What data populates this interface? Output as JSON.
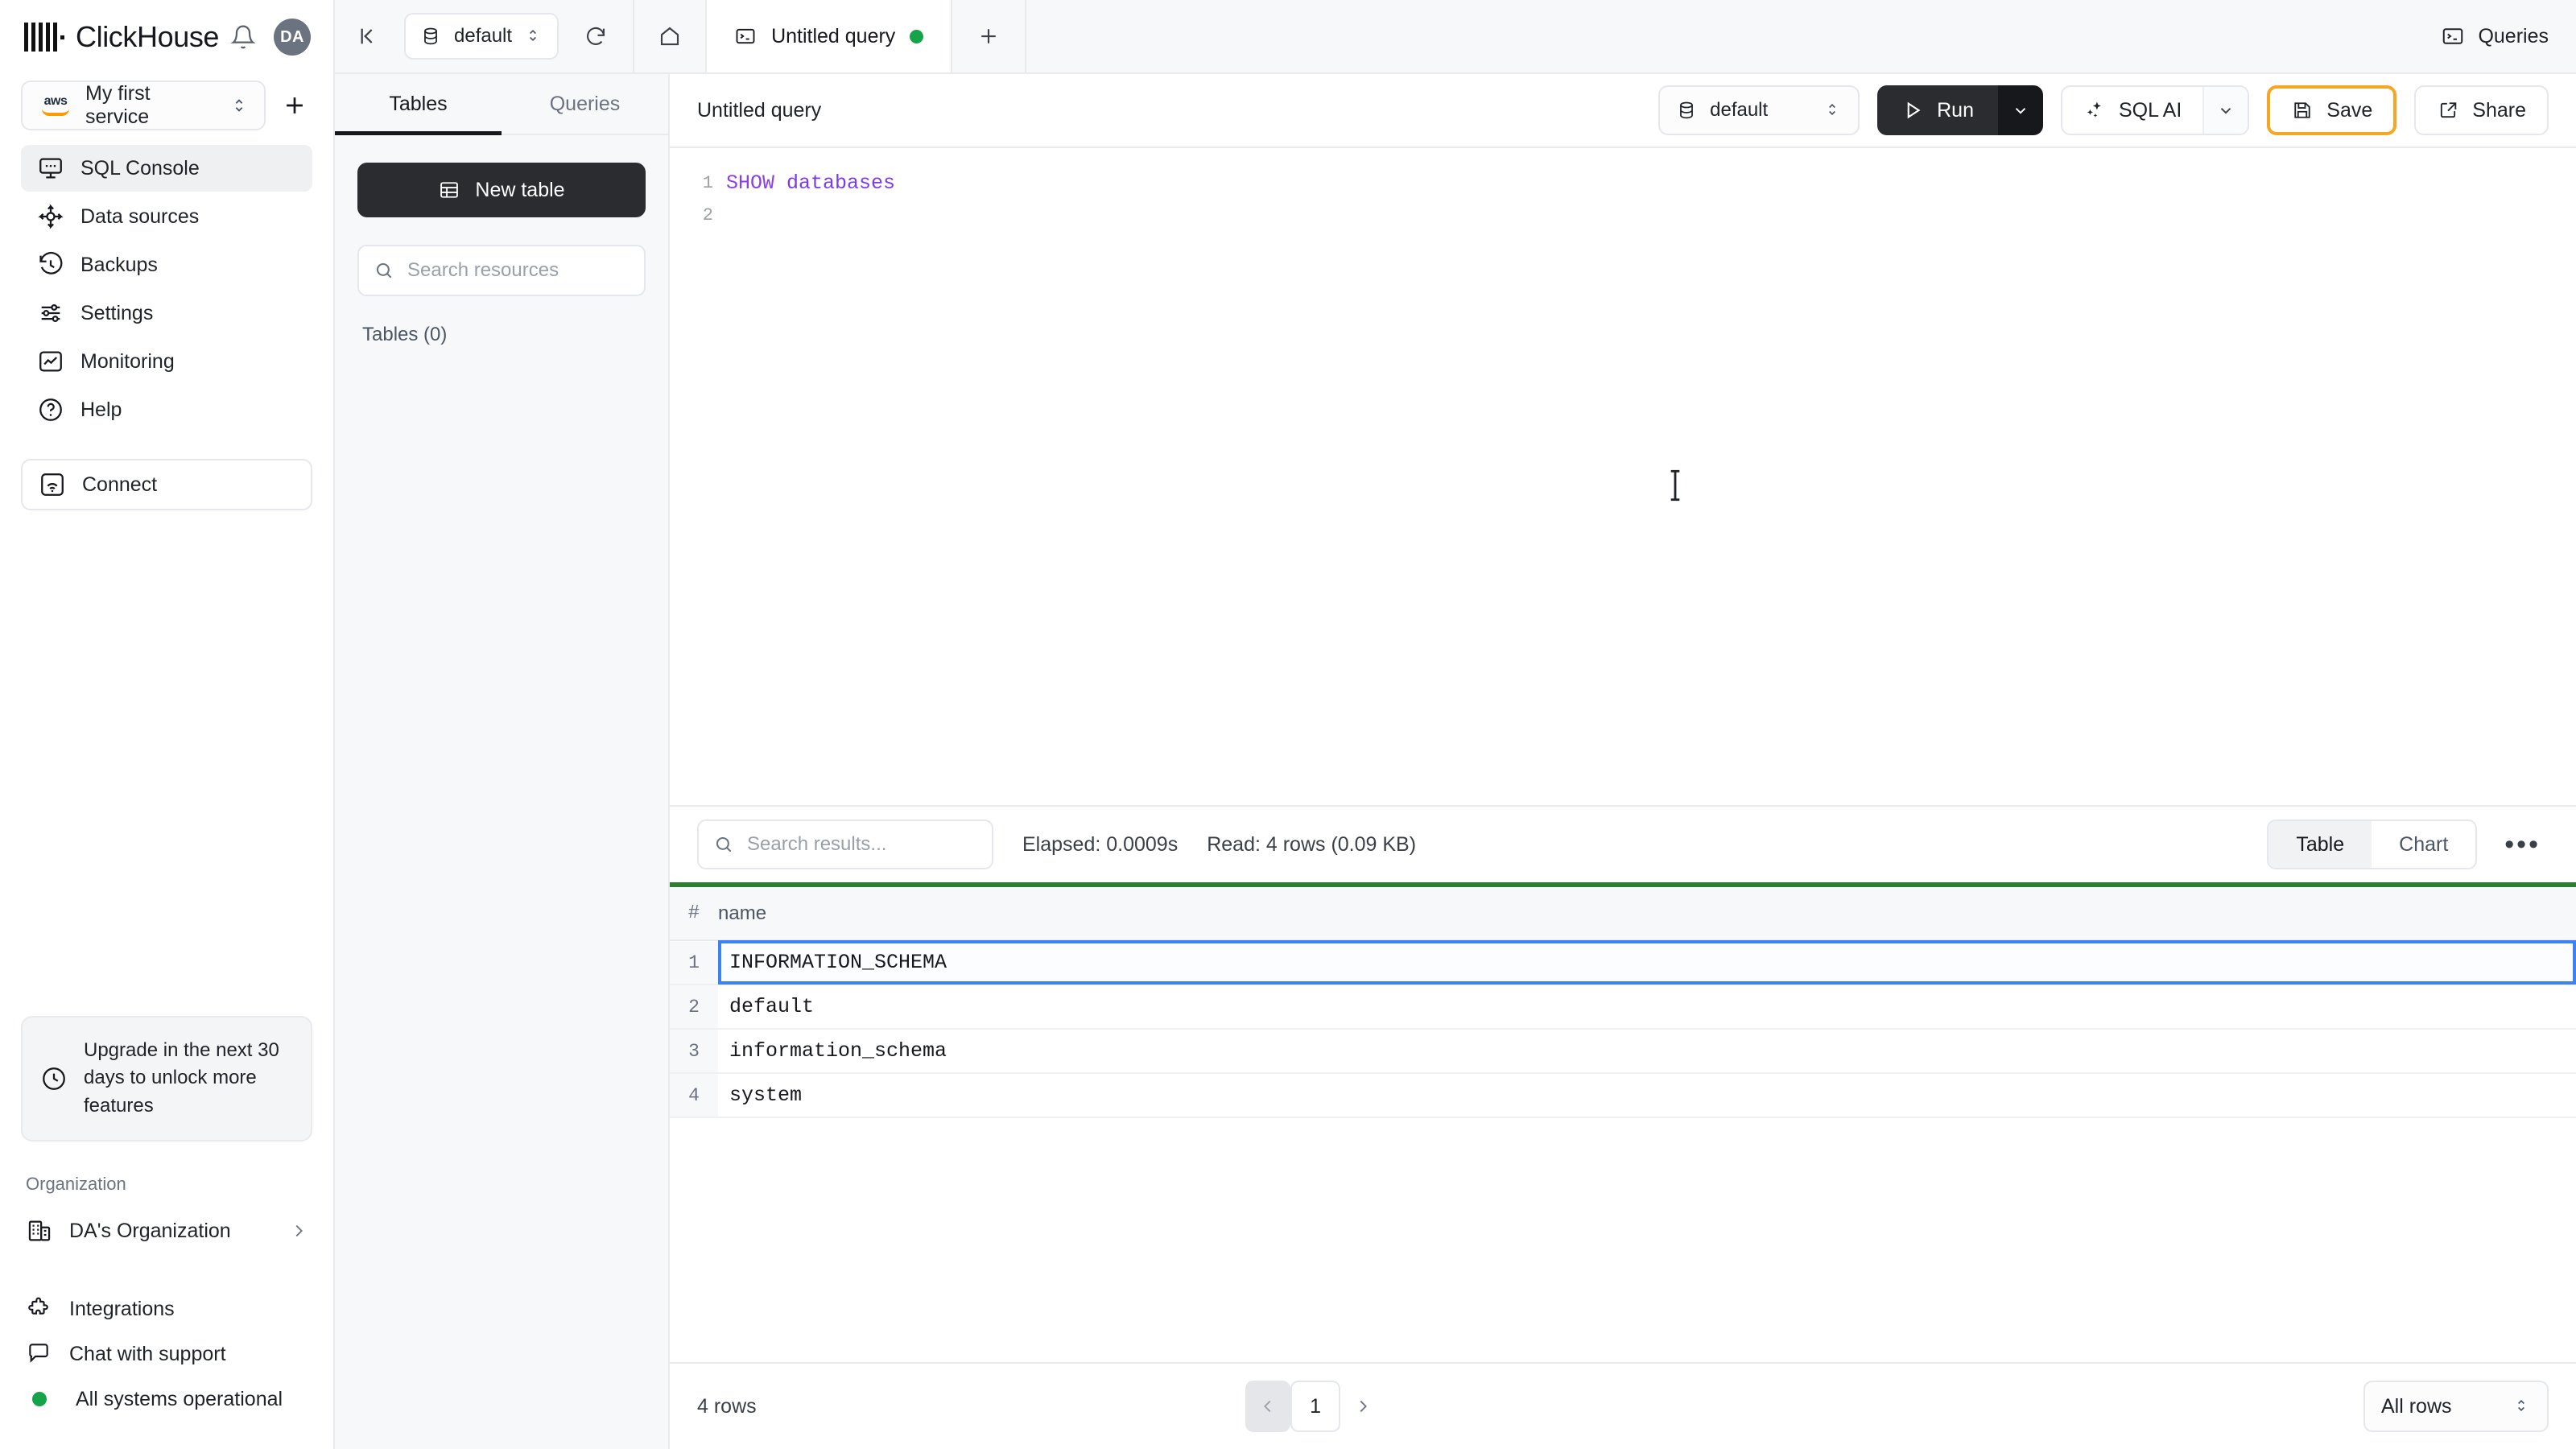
{
  "brand": {
    "name": "ClickHouse",
    "avatar_initials": "DA"
  },
  "service": {
    "name": "My first service",
    "cloud_provider": "aws"
  },
  "sidebar": {
    "items": [
      {
        "label": "SQL Console",
        "icon": "sql-console-icon",
        "active": true
      },
      {
        "label": "Data sources",
        "icon": "data-sources-icon",
        "active": false
      },
      {
        "label": "Backups",
        "icon": "backups-icon",
        "active": false
      },
      {
        "label": "Settings",
        "icon": "settings-icon",
        "active": false
      },
      {
        "label": "Monitoring",
        "icon": "monitoring-icon",
        "active": false
      },
      {
        "label": "Help",
        "icon": "help-icon",
        "active": false
      }
    ],
    "connect_label": "Connect",
    "upgrade_banner": "Upgrade in the next 30 days to unlock more features",
    "organization_label": "Organization",
    "organization_name": "DA's Organization",
    "bottom_links": [
      {
        "label": "Integrations",
        "icon": "integrations-icon"
      },
      {
        "label": "Chat with support",
        "icon": "chat-icon"
      },
      {
        "label": "All systems operational",
        "icon": "status-dot"
      }
    ],
    "status_color": "#16a34a"
  },
  "topbar": {
    "database": "default",
    "tab_title": "Untitled query",
    "tab_unsaved": true,
    "queries_label": "Queries"
  },
  "tables_panel": {
    "tabs": [
      {
        "label": "Tables",
        "active": true
      },
      {
        "label": "Queries",
        "active": false
      }
    ],
    "new_table_label": "New table",
    "search_placeholder": "Search resources",
    "tables_count_label": "Tables (0)"
  },
  "editor": {
    "title": "Untitled query",
    "database": "default",
    "run_label": "Run",
    "ai_label": "SQL AI",
    "save_label": "Save",
    "share_label": "Share",
    "save_focus_color": "#f5a623",
    "lines": [
      {
        "num": "1",
        "keyword": "SHOW",
        "identifier": "databases"
      },
      {
        "num": "2",
        "keyword": "",
        "identifier": ""
      }
    ]
  },
  "results": {
    "search_placeholder": "Search results...",
    "elapsed": "Elapsed: 0.0009s",
    "read": "Read: 4 rows (0.09 KB)",
    "view_modes": [
      {
        "label": "Table",
        "active": true
      },
      {
        "label": "Chart",
        "active": false
      }
    ],
    "more_label": "•••",
    "columns": [
      "#",
      "name"
    ],
    "rows": [
      {
        "idx": "1",
        "name": "INFORMATION_SCHEMA",
        "selected": true
      },
      {
        "idx": "2",
        "name": "default",
        "selected": false
      },
      {
        "idx": "3",
        "name": "information_schema",
        "selected": false
      },
      {
        "idx": "4",
        "name": "system",
        "selected": false
      }
    ],
    "row_count_label": "4 rows",
    "page": "1",
    "page_size": "All rows",
    "accent_line_color": "#2e7d32",
    "selection_color": "#3b82f6"
  }
}
